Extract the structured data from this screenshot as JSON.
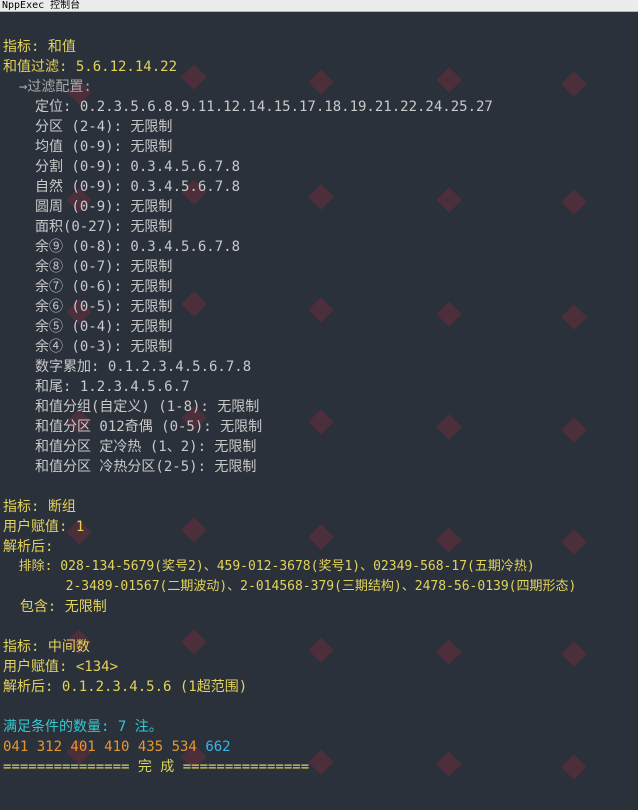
{
  "window": {
    "title": "NppExec 控制台"
  },
  "section1": {
    "header": "指标: 和值",
    "filter": "和值过滤: 5.6.12.14.22",
    "config_label": "→过滤配置:",
    "items": [
      "定位: 0.2.3.5.6.8.9.11.12.14.15.17.18.19.21.22.24.25.27",
      "分区 (2-4): 无限制",
      "均值 (0-9): 无限制",
      "分割 (0-9): 0.3.4.5.6.7.8",
      "自然 (0-9): 0.3.4.5.6.7.8",
      "圆周 (0-9): 无限制",
      "面积(0-27): 无限制",
      "余⑨ (0-8): 0.3.4.5.6.7.8",
      "余⑧ (0-7): 无限制",
      "余⑦ (0-6): 无限制",
      "余⑥ (0-5): 无限制",
      "余⑤ (0-4): 无限制",
      "余④ (0-3): 无限制",
      "数字累加: 0.1.2.3.4.5.6.7.8",
      "和尾: 1.2.3.4.5.6.7",
      "和值分组(自定义) (1-8): 无限制",
      "和值分区 012奇偶 (0-5): 无限制",
      "和值分区 定冷热 (1、2): 无限制",
      "和值分区 冷热分区(2-5): 无限制"
    ]
  },
  "section2": {
    "header": "指标: 断组",
    "user_value": "用户赋值: 1",
    "parsed_label": "解析后:",
    "exclude_line1": "  排除: 028-134-5679(奖号2)、459-012-3678(奖号1)、02349-568-17(五期冷热)",
    "exclude_line2": "        2-3489-01567(二期波动)、2-014568-379(三期结构)、2478-56-0139(四期形态)",
    "include": "  包含: 无限制"
  },
  "section3": {
    "header": "指标: 中间数",
    "user_value": "用户赋值: <134>",
    "parsed": "解析后: 0.1.2.3.4.5.6 (1超范围)"
  },
  "result": {
    "count": "满足条件的数量: 7 注。",
    "numbers_orange": "041 312 401 410 435 534",
    "numbers_blue": "662",
    "done": "=============== 完 成 ==============="
  },
  "colors": {
    "background": "#2b313b",
    "header_yellow": "#e2d35a",
    "text_white": "#c9c9c9",
    "cyan": "#38c8d0",
    "orange": "#e8962f",
    "blue": "#38b6e8"
  }
}
